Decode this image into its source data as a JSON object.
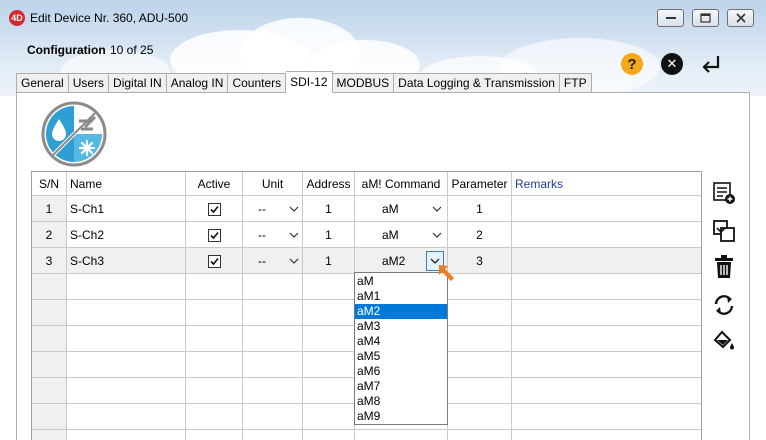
{
  "window": {
    "title": "Edit Device Nr. 360, ADU-500",
    "app_icon_text": "4D"
  },
  "header": {
    "config_label": "Configuration",
    "config_value": "10 of 25"
  },
  "tabs": [
    {
      "label": "General",
      "active": false
    },
    {
      "label": "Users",
      "active": false
    },
    {
      "label": "Digital IN",
      "active": false
    },
    {
      "label": "Analog IN",
      "active": false
    },
    {
      "label": "Counters",
      "active": false
    },
    {
      "label": "SDI-12",
      "active": true
    },
    {
      "label": "MODBUS",
      "active": false
    },
    {
      "label": "Data Logging & Transmission",
      "active": false
    },
    {
      "label": "FTP",
      "active": false
    }
  ],
  "table": {
    "columns": [
      "S/N",
      "Name",
      "Active",
      "Unit",
      "Address",
      "aM! Command",
      "Parameter",
      "Remarks"
    ],
    "rows": [
      {
        "sn": "1",
        "name": "S-Ch1",
        "active": true,
        "unit": "--",
        "address": "1",
        "command": "aM",
        "parameter": "1",
        "remarks": ""
      },
      {
        "sn": "2",
        "name": "S-Ch2",
        "active": true,
        "unit": "--",
        "address": "1",
        "command": "aM",
        "parameter": "2",
        "remarks": ""
      },
      {
        "sn": "3",
        "name": "S-Ch3",
        "active": true,
        "unit": "--",
        "address": "1",
        "command": "aM2",
        "parameter": "3",
        "remarks": ""
      }
    ]
  },
  "command_dropdown": {
    "options": [
      "aM",
      "aM1",
      "aM2",
      "aM3",
      "aM4",
      "aM5",
      "aM6",
      "aM7",
      "aM8",
      "aM9"
    ],
    "selected": "aM2"
  },
  "colors": {
    "selection": "#0078d7",
    "help": "#f5a81a",
    "cursor": "#f07b22",
    "logo_blue": "#3aa9d8"
  },
  "icons": [
    "help-icon",
    "close-icon",
    "enter-icon",
    "add-row-icon",
    "copy-icon",
    "delete-icon",
    "refresh-icon",
    "fill-icon"
  ]
}
